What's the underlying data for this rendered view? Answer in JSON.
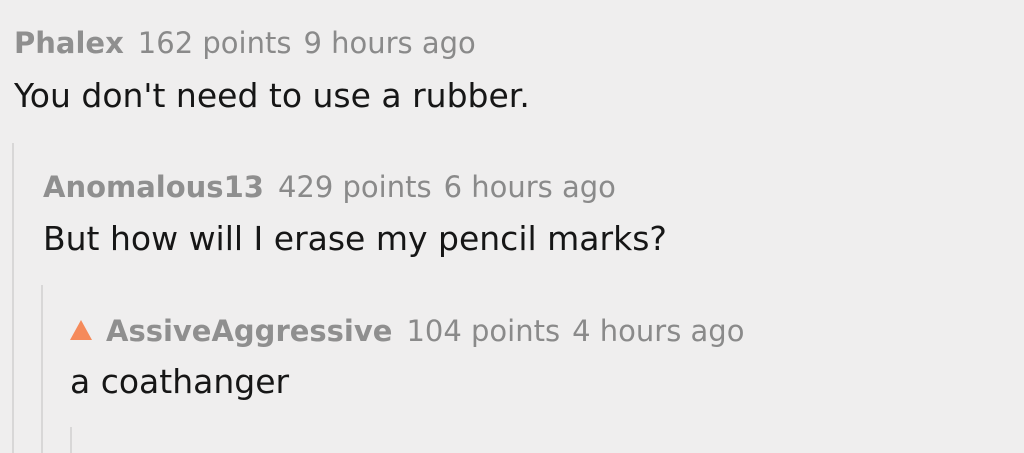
{
  "comments": [
    {
      "author": "Phalex",
      "points": "162 points",
      "time": "9 hours ago",
      "text": "You don't need to use a rubber."
    },
    {
      "author": "Anomalous13",
      "points": "429 points",
      "time": "6 hours ago",
      "text": "But how will I erase my pencil marks?"
    },
    {
      "author": "AssiveAggressive",
      "points": "104 points",
      "time": "4 hours ago",
      "text": "a coathanger",
      "op_icon": "op-triangle-icon",
      "op_icon_color": "#f58a5a"
    }
  ]
}
